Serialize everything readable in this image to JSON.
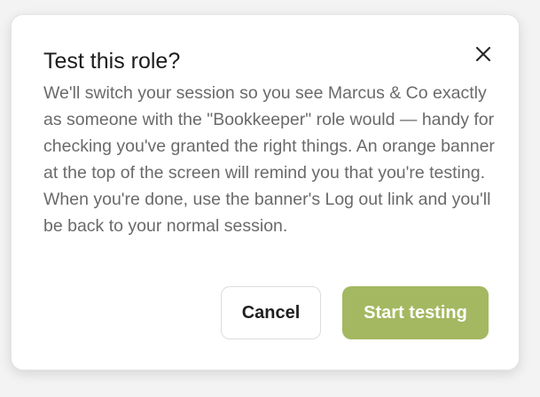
{
  "dialog": {
    "title": "Test this role?",
    "body": "We'll switch your session so you see Marcus & Co exactly as someone with the \"Bookkeeper\" role would — handy for checking you've granted the right things. An orange banner at the top of the screen will remind you that you're testing. When you're done, use the banner's Log out link and you'll be back to your normal session.",
    "close_icon": "close-icon",
    "cancel_label": "Cancel",
    "confirm_label": "Start testing"
  },
  "colors": {
    "primary_button": "#a4b861",
    "body_text": "#6a6a6a",
    "title_text": "#1c1c1c"
  }
}
